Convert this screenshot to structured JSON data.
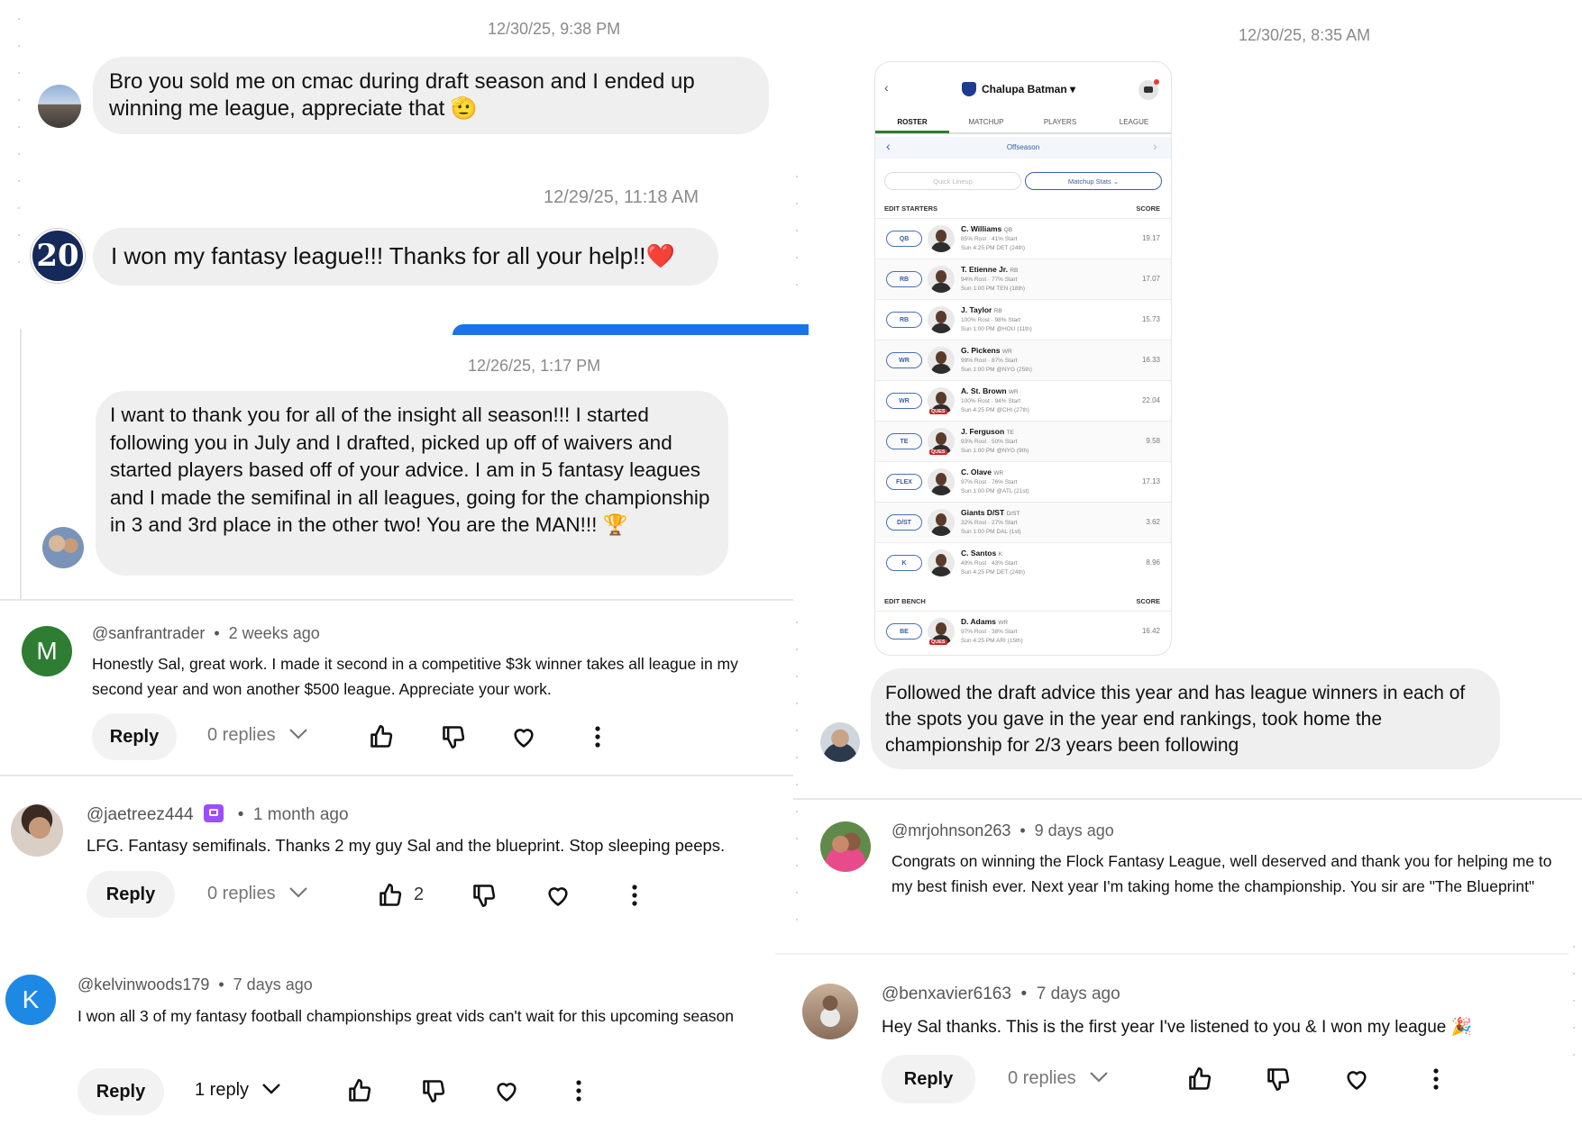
{
  "timestamps": {
    "left_1": "12/30/25, 9:38 PM",
    "left_2": "12/29/25, 11:18 AM",
    "left_3": "12/26/25, 1:17 PM",
    "right_1": "12/30/25, 8:35 AM"
  },
  "messages": {
    "cmac": "Bro you sold me on cmac during draft season and I ended up winning me league, appreciate that 🫡",
    "won": "I won my fantasy league!!! Thanks for all your help!!❤️",
    "insight": "I want to thank you for all of the insight all season!!! I started following you in July and I drafted, picked up off of waivers and started players based off of your advice. I am in 5 fantasy leagues and I made the semifinal in all leagues, going for the championship in 3 and 3rd place in the other two! You are the MAN!!! 🏆",
    "followed": "Followed the draft advice this year and has league winners in each of the spots you gave in the year end rankings, took home the championship for 2/3 years been following",
    "avatar_20": "20"
  },
  "comments": [
    {
      "handle": "@sanfrantrader",
      "time": "2 weeks ago",
      "initial": "M",
      "avatar_color": "#2e7d32",
      "text": "Honestly Sal, great work. I made it second in a competitive $3k winner takes all league in my second year and won another $500 league. Appreciate your work.",
      "reply_label": "Reply",
      "replies": "0 replies",
      "likes": ""
    },
    {
      "handle": "@jaetreez444",
      "time": "1 month ago",
      "initial": "",
      "avatar_color": "#8d6e63",
      "text": "LFG. Fantasy semifinals. Thanks 2 my guy Sal and the blueprint. Stop sleeping peeps.",
      "reply_label": "Reply",
      "replies": "0 replies",
      "likes": "2"
    },
    {
      "handle": "@kelvinwoods179",
      "time": "7 days ago",
      "initial": "K",
      "avatar_color": "#1e88e5",
      "text": "I won all 3 of my fantasy football championships great vids can't wait for this upcoming season",
      "reply_label": "Reply",
      "replies": "1 reply",
      "likes": ""
    },
    {
      "handle": "@mrjohnson263",
      "time": "9 days ago",
      "initial": "",
      "avatar_color": "#6d8f4e",
      "text": "Congrats on winning the Flock Fantasy League, well deserved and thank you for helping me to my best finish ever. Next year I'm taking home the championship. You sir are \"The Blueprint\"",
      "reply_label": "",
      "replies": "",
      "likes": ""
    },
    {
      "handle": "@benxavier6163",
      "time": "7 days ago",
      "initial": "",
      "avatar_color": "#a1887f",
      "text": "Hey Sal thanks. This is the first year I've listened to you & I won my league 🎉",
      "reply_label": "Reply",
      "replies": "0 replies",
      "likes": ""
    }
  ],
  "phone": {
    "team_name": "Chalupa Batman",
    "tabs": [
      "ROSTER",
      "MATCHUP",
      "PLAYERS",
      "LEAGUE"
    ],
    "week_label": "Offseason",
    "quick_lineup": "Quick Lineup",
    "matchup_stats": "Matchup Stats",
    "starters_header": "EDIT STARTERS",
    "bench_header": "EDIT BENCH",
    "score_header": "SCORE",
    "ques_label": "QUES",
    "starters": [
      {
        "pos": "QB",
        "name": "C. Williams",
        "tag": "QB",
        "info1": "85% Rost · 41% Start",
        "info2": "Sun 4:25 PM DET (24th)",
        "score": "19.17",
        "ques": false
      },
      {
        "pos": "RB",
        "name": "T. Etienne Jr.",
        "tag": "RB",
        "info1": "94% Rost · 77% Start",
        "info2": "Sun 1:00 PM TEN (18th)",
        "score": "17.07",
        "ques": false
      },
      {
        "pos": "RB",
        "name": "J. Taylor",
        "tag": "RB",
        "info1": "100% Rost · 98% Start",
        "info2": "Sun 1:00 PM @HOU (11th)",
        "score": "15.73",
        "ques": false
      },
      {
        "pos": "WR",
        "name": "G. Pickens",
        "tag": "WR",
        "info1": "99% Rost · 87% Start",
        "info2": "Sun 1:00 PM @NYG (25th)",
        "score": "16.33",
        "ques": false
      },
      {
        "pos": "WR",
        "name": "A. St. Brown",
        "tag": "WR",
        "info1": "100% Rost · 94% Start",
        "info2": "Sun 4:25 PM @CHI (27th)",
        "score": "22.04",
        "ques": true
      },
      {
        "pos": "TE",
        "name": "J. Ferguson",
        "tag": "TE",
        "info1": "93% Rost · 50% Start",
        "info2": "Sun 1:00 PM @NYG (9th)",
        "score": "9.58",
        "ques": true
      },
      {
        "pos": "FLEX",
        "name": "C. Olave",
        "tag": "WR",
        "info1": "97% Rost · 76% Start",
        "info2": "Sun 1:00 PM @ATL (21st)",
        "score": "17.13",
        "ques": false
      },
      {
        "pos": "D/ST",
        "name": "Giants D/ST",
        "tag": "D/ST",
        "info1": "32% Rost · 27% Start",
        "info2": "Sun 1:00 PM DAL (1st)",
        "score": "3.62",
        "ques": false
      },
      {
        "pos": "K",
        "name": "C. Santos",
        "tag": "K",
        "info1": "49% Rost · 43% Start",
        "info2": "Sun 4:25 PM DET (24th)",
        "score": "8.96",
        "ques": false
      }
    ],
    "bench": [
      {
        "pos": "BE",
        "name": "D. Adams",
        "tag": "WR",
        "info1": "97% Rost · 38% Start",
        "info2": "Sun 4:25 PM ARI (15th)",
        "score": "16.42",
        "ques": true
      }
    ]
  },
  "colors": {
    "accent_blue": "#1a73e8",
    "espn_green": "#2e7d32",
    "bubble": "#efefef"
  }
}
